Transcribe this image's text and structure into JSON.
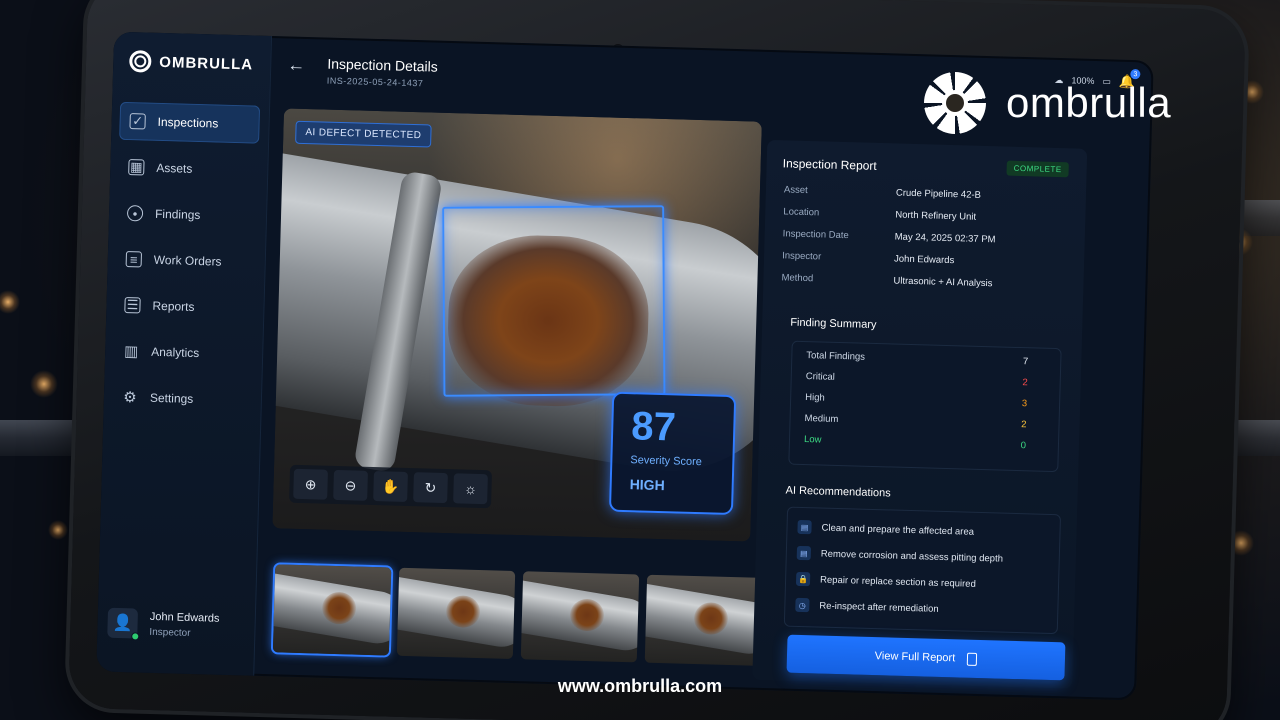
{
  "brand": {
    "name": "ombrulla",
    "website": "www.ombrulla.com"
  },
  "app": {
    "logo_text": "OMBRULLA"
  },
  "sidebar": {
    "items": [
      {
        "label": "Inspections",
        "icon": "inspections-icon",
        "active": true
      },
      {
        "label": "Assets",
        "icon": "assets-icon"
      },
      {
        "label": "Findings",
        "icon": "findings-icon"
      },
      {
        "label": "Work Orders",
        "icon": "work-orders-icon"
      },
      {
        "label": "Reports",
        "icon": "reports-icon"
      },
      {
        "label": "Analytics",
        "icon": "analytics-icon"
      },
      {
        "label": "Settings",
        "icon": "gear-icon"
      }
    ],
    "user": {
      "name": "John Edwards",
      "role": "Inspector"
    }
  },
  "header": {
    "title": "Inspection Details",
    "subtitle": "INS-2025-05-24-1437",
    "battery": "100%",
    "notifications": "3"
  },
  "viewer": {
    "tag": "AI DEFECT DETECTED",
    "severity_score": "87",
    "severity_label": "Severity Score",
    "severity_level": "HIGH"
  },
  "report": {
    "title": "Inspection Report",
    "status": "COMPLETE",
    "fields": [
      {
        "key": "Asset",
        "value": "Crude Pipeline 42-B"
      },
      {
        "key": "Location",
        "value": "North Refinery Unit"
      },
      {
        "key": "Inspection Date",
        "value": "May 24, 2025   02:37 PM"
      },
      {
        "key": "Inspector",
        "value": "John Edwards"
      },
      {
        "key": "Method",
        "value": "Ultrasonic + AI Analysis"
      }
    ],
    "finding_summary_title": "Finding Summary",
    "findings": [
      {
        "label": "Total Findings",
        "value": "7",
        "color": "#e6ecf5"
      },
      {
        "label": "Critical",
        "value": "2",
        "color": "#ff4d4d"
      },
      {
        "label": "High",
        "value": "3",
        "color": "#ff9f1a"
      },
      {
        "label": "Medium",
        "value": "2",
        "color": "#ffc93c"
      },
      {
        "label": "Low",
        "value": "0",
        "color": "#3ddc84"
      }
    ],
    "recommendations_title": "AI Recommendations",
    "recommendations": [
      "Clean and prepare the affected area",
      "Remove corrosion and assess pitting depth",
      "Repair or replace section as required",
      "Re-inspect after remediation"
    ],
    "cta": "View Full Report"
  },
  "colors": {
    "accent": "#1f74ff",
    "complete": "#3ddc84"
  }
}
